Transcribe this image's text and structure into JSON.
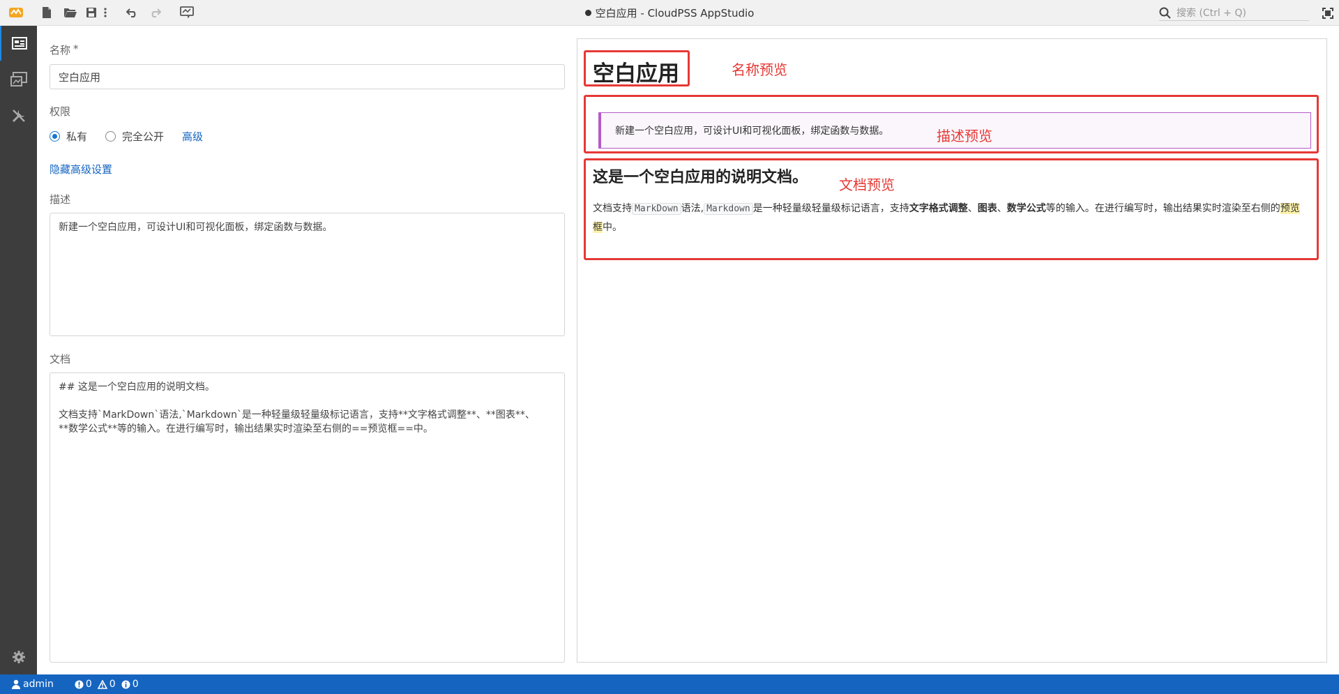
{
  "window": {
    "title": "空白应用 - CloudPSS AppStudio",
    "search_placeholder": "搜索 (Ctrl + Q)"
  },
  "colors": {
    "accent": "#1565c0",
    "activity_bar": "#3d3d3d",
    "annotation": "#e53935",
    "desc_border": "#b35bc7"
  },
  "form": {
    "name_label": "名称",
    "name_required_mark": "*",
    "name_value": "空白应用",
    "permission_label": "权限",
    "radio_private": "私有",
    "radio_public": "完全公开",
    "advanced_link": "高级",
    "hide_advanced_link": "隐藏高级设置",
    "description_label": "描述",
    "description_value": "新建一个空白应用，可设计UI和可视化面板，绑定函数与数据。",
    "document_label": "文档",
    "document_value": "## 这是一个空白应用的说明文档。\n\n文档支持`MarkDown`语法,`Markdown`是一种轻量级轻量级标记语言，支持**文字格式调整**、**图表**、\n**数学公式**等的输入。在进行编写时，输出结果实时渲染至右侧的==预览框==中。"
  },
  "preview": {
    "title": "空白应用",
    "description": "新建一个空白应用，可设计UI和可视化面板，绑定函数与数据。",
    "doc_heading": "这是一个空白应用的说明文档。",
    "doc_p": {
      "t1": "文档支持",
      "c1": "MarkDown",
      "t2": "语法,",
      "c2": "Markdown",
      "t3": "是一种轻量级轻量级标记语言，支持",
      "b1": "文字格式调整",
      "t4": "、",
      "b2": "图表",
      "t5": "、",
      "b3": "数学公式",
      "t6": "等的输入。在进行编写时，输出结果实时渲染至右侧的",
      "m1": "预览框",
      "t7": "中。"
    },
    "annotations": {
      "name": "名称预览",
      "description": "描述预览",
      "document": "文档预览"
    }
  },
  "status": {
    "user": "admin",
    "errors": "0",
    "warnings": "0",
    "infos": "0"
  },
  "icons": {
    "titlebar": [
      "app-logo-icon",
      "new-file-icon",
      "open-folder-icon",
      "save-icon",
      "more-vertical-icon",
      "undo-icon",
      "redo-icon",
      "preview-icon",
      "search-icon",
      "maximize-icon"
    ],
    "activity": [
      "form-icon",
      "gallery-icon",
      "tools-icon",
      "gear-icon"
    ]
  }
}
